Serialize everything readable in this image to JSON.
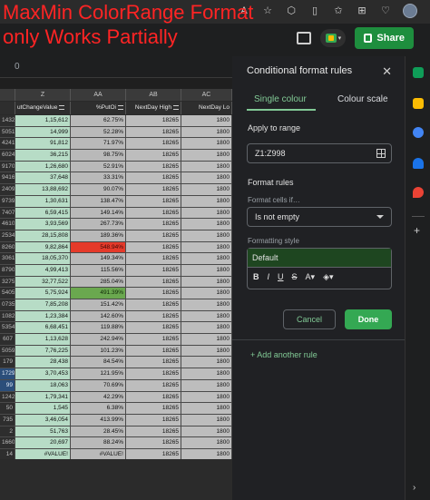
{
  "caption": {
    "line1": "MaxMin ColorRange Format",
    "line2": "only Works Partially"
  },
  "header": {
    "share_label": "Share"
  },
  "toolbar": {
    "namebox_value": "0"
  },
  "grid": {
    "columns": [
      {
        "id": "Z",
        "letter": "Z"
      },
      {
        "id": "AA",
        "letter": "AA"
      },
      {
        "id": "AB",
        "letter": "AB"
      },
      {
        "id": "AC",
        "letter": "AC"
      }
    ],
    "field_names": {
      "Z": "utChangeValue",
      "AA": "%PutOi",
      "AB": "NextDay High",
      "AC": "NextDay Lo"
    },
    "rows": [
      {
        "rn": "1432",
        "z": "1,15,612",
        "aa": "62.75%",
        "ab": "18265",
        "ac": "1800"
      },
      {
        "rn": "5051",
        "z": "14,999",
        "aa": "52.28%",
        "ab": "18265",
        "ac": "1800"
      },
      {
        "rn": "4241",
        "z": "91,812",
        "aa": "71.97%",
        "ab": "18265",
        "ac": "1800"
      },
      {
        "rn": "6024",
        "z": "36,215",
        "aa": "98.75%",
        "ab": "18265",
        "ac": "1800"
      },
      {
        "rn": "9170",
        "z": "1,26,680",
        "aa": "52.91%",
        "ab": "18265",
        "ac": "1800"
      },
      {
        "rn": "9416",
        "z": "37,648",
        "aa": "33.31%",
        "ab": "18265",
        "ac": "1800"
      },
      {
        "rn": "2409",
        "z": "13,88,692",
        "aa": "90.07%",
        "ab": "18265",
        "ac": "1800"
      },
      {
        "rn": "9739",
        "z": "1,30,631",
        "aa": "138.47%",
        "ab": "18265",
        "ac": "1800"
      },
      {
        "rn": "7407",
        "z": "6,59,415",
        "aa": "149.14%",
        "ab": "18265",
        "ac": "1800"
      },
      {
        "rn": "4610",
        "z": "3,93,569",
        "aa": "267.73%",
        "ab": "18265",
        "ac": "1800"
      },
      {
        "rn": "2534",
        "z": "28,15,808",
        "aa": "189.36%",
        "ab": "18265",
        "ac": "1800"
      },
      {
        "rn": "8260",
        "z": "9,82,864",
        "aa": "548.94%",
        "ab": "18265",
        "ac": "1800",
        "hl": "red"
      },
      {
        "rn": "3061",
        "z": "18,05,370",
        "aa": "149.34%",
        "ab": "18265",
        "ac": "1800"
      },
      {
        "rn": "8790",
        "z": "4,99,413",
        "aa": "115.56%",
        "ab": "18265",
        "ac": "1800"
      },
      {
        "rn": "3275",
        "z": "32,77,522",
        "aa": "285.04%",
        "ab": "18265",
        "ac": "1800"
      },
      {
        "rn": "5405",
        "z": "5,75,924",
        "aa": "491.39%",
        "ab": "18265",
        "ac": "1800",
        "hl": "green"
      },
      {
        "rn": "0735",
        "z": "7,85,208",
        "aa": "151.42%",
        "ab": "18265",
        "ac": "1800"
      },
      {
        "rn": "1082",
        "z": "1,23,384",
        "aa": "142.60%",
        "ab": "18265",
        "ac": "1800"
      },
      {
        "rn": "5354",
        "z": "6,68,451",
        "aa": "119.88%",
        "ab": "18265",
        "ac": "1800"
      },
      {
        "rn": "607",
        "z": "1,13,628",
        "aa": "242.94%",
        "ab": "18265",
        "ac": "1800"
      },
      {
        "rn": "5059",
        "z": "7,76,225",
        "aa": "101.23%",
        "ab": "18265",
        "ac": "1800"
      },
      {
        "rn": "179",
        "z": "28,438",
        "aa": "84.54%",
        "ab": "18265",
        "ac": "1800"
      },
      {
        "rn": "1729",
        "z": "3,70,453",
        "aa": "121.95%",
        "ab": "18265",
        "ac": "1800",
        "sel": true
      },
      {
        "rn": "99",
        "z": "18,063",
        "aa": "70.69%",
        "ab": "18265",
        "ac": "1800",
        "sel": true
      },
      {
        "rn": "1242",
        "z": "1,79,341",
        "aa": "42.29%",
        "ab": "18265",
        "ac": "1800"
      },
      {
        "rn": "50",
        "z": "1,545",
        "aa": "6.38%",
        "ab": "18265",
        "ac": "1800"
      },
      {
        "rn": "735",
        "z": "3,46,054",
        "aa": "413.99%",
        "ab": "18265",
        "ac": "1800"
      },
      {
        "rn": "2",
        "z": "51,763",
        "aa": "28.45%",
        "ab": "18265",
        "ac": "1800"
      },
      {
        "rn": "1660",
        "z": "20,697",
        "aa": "88.24%",
        "ab": "18265",
        "ac": "1800"
      },
      {
        "rn": "14",
        "z": "#VALUE!",
        "aa": "#VALUE!",
        "ab": "18265",
        "ac": "1800"
      },
      {
        "rn": "820",
        "z": "4,62,265",
        "aa": "256.52%",
        "ab": "18265",
        "ac": "1800"
      }
    ]
  },
  "panel": {
    "title": "Conditional format rules",
    "tabs": [
      {
        "label": "Single colour"
      },
      {
        "label": "Colour scale"
      }
    ],
    "apply_to_range_label": "Apply to range",
    "range_value": "Z1:Z998",
    "format_rules_label": "Format rules",
    "format_cells_if_label": "Format cells if…",
    "condition_value": "Is not empty",
    "formatting_style_label": "Formatting style",
    "style_value": "Default",
    "cancel_label": "Cancel",
    "done_label": "Done",
    "add_rule_label": "Add another rule"
  },
  "colors": {
    "accent_green": "#81c995",
    "done_green": "#34a853",
    "red_highlight": "#e53a2a",
    "green_highlight": "#6aa84f"
  }
}
